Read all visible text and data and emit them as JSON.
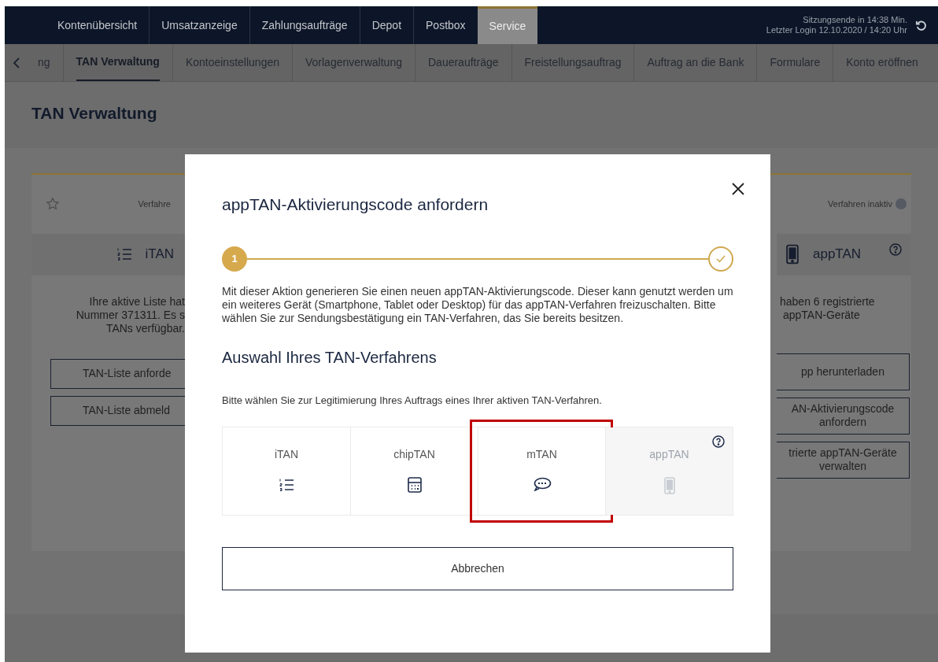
{
  "top_nav": {
    "items": [
      {
        "label": "Kontenübersicht",
        "selected": false
      },
      {
        "label": "Umsatzanzeige",
        "selected": false
      },
      {
        "label": "Zahlungsaufträge",
        "selected": false
      },
      {
        "label": "Depot",
        "selected": false
      },
      {
        "label": "Postbox",
        "selected": false
      },
      {
        "label": "Service",
        "selected": true
      }
    ],
    "session": [
      "Sitzungsende in 14:38 Min.",
      "Letzter Login 12.10.2020 / 14:20 Uhr"
    ]
  },
  "sub_nav": {
    "items": [
      {
        "label": "ng",
        "selected": false
      },
      {
        "label": "TAN Verwaltung",
        "selected": true
      },
      {
        "label": "Kontoeinstellungen",
        "selected": false
      },
      {
        "label": "Vorlagenverwaltung",
        "selected": false
      },
      {
        "label": "Daueraufträge",
        "selected": false
      },
      {
        "label": "Freistellungsauftrag",
        "selected": false
      },
      {
        "label": "Auftrag an die Bank",
        "selected": false
      },
      {
        "label": "Formulare",
        "selected": false
      },
      {
        "label": "Konto eröffnen",
        "selected": false
      }
    ]
  },
  "page_title": "TAN Verwaltung",
  "background_card": {
    "left": {
      "status": "Verfahre",
      "title": "iTAN",
      "description": [
        "Ihre aktive Liste hat",
        "Nummer 371311. Es s",
        "TANs verfügbar."
      ],
      "buttons": [
        [
          "TAN-Liste anforde"
        ],
        [
          "TAN-Liste abmeld"
        ]
      ]
    },
    "right": {
      "status": "Verfahren inaktiv",
      "active": false,
      "title": "appTAN",
      "description": [
        "haben 6 registrierte",
        "appTAN-Geräte"
      ],
      "buttons": [
        [
          "pp herunterladen"
        ],
        [
          "AN-Aktivierungscode",
          "anfordern"
        ],
        [
          "trierte appTAN-Geräte",
          "verwalten"
        ]
      ]
    }
  },
  "dialog": {
    "title": "appTAN-Aktivierungscode anfordern",
    "steps": [
      {
        "number": "1",
        "done": false
      },
      {
        "done": true
      }
    ],
    "text": "Mit dieser Aktion generieren Sie einen neuen appTAN-Aktivierungscode. Dieser kann genutzt werden um ein weiteres Gerät (Smartphone, Tablet oder Desktop) für das appTAN-Verfahren freizuschalten. Bitte wählen Sie zur Sendungsbestätigung ein TAN-Verfahren, das Sie bereits besitzen.",
    "heading": "Auswahl Ihres TAN-Verfahrens",
    "instruction": "Bitte wählen Sie zur Legitimierung Ihres Auftrags eines Ihrer aktiven TAN-Verfahren.",
    "options": [
      {
        "label": "iTAN",
        "kind": "list",
        "disabled": false,
        "highlighted": false,
        "help": false
      },
      {
        "label": "chipTAN",
        "kind": "calculator",
        "disabled": false,
        "highlighted": false,
        "help": false
      },
      {
        "label": "mTAN",
        "kind": "sms",
        "disabled": false,
        "highlighted": true,
        "help": false
      },
      {
        "label": "appTAN",
        "kind": "phone",
        "disabled": true,
        "highlighted": false,
        "help": true
      }
    ],
    "cancel": "Abbrechen"
  }
}
